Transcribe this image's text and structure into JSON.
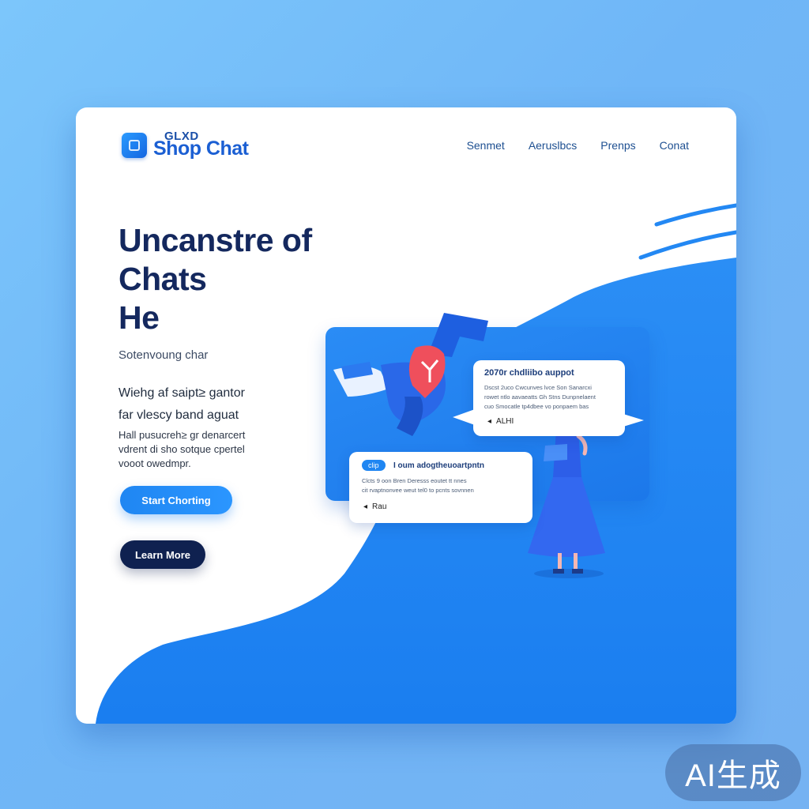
{
  "brand": {
    "small": "GLXD",
    "name": "Shop Chat"
  },
  "nav": [
    "Senmet",
    "Aeruslbcs",
    "Prenps",
    "Conat"
  ],
  "hero": {
    "title_lines": [
      "Uncanstre of",
      "Chats",
      "He"
    ],
    "subtitle": "Sotenvoung char",
    "lead_lines": [
      "Wiehg af saipt≥ gantor",
      "far vlescy band aguat"
    ],
    "body_lines": [
      "Hall pusucreh≥ gr denarcert",
      "vdrent di sho sotque cpertel",
      "vooot owedmpr."
    ]
  },
  "buttons": {
    "primary": "Start Chorting",
    "secondary": "Learn More"
  },
  "chat_bubble_1": {
    "title": "2070r chdliibo auppot",
    "lines": [
      "Dscst 2uco Cwcunves lvce Son Sanarcxi",
      "rowet ntlo aavaeatts Gh Stns Dunpnelaent",
      "cuo Smocatle tp4dbee vo ponpaem bas"
    ],
    "back": "ALHI"
  },
  "chat_bubble_2": {
    "pill": "clip",
    "title": "I oum adogtheuoartpntn",
    "lines": [
      "Clcts 9 oon Bren Deresss eoutet tt nnes",
      "cit rvaptnonvee weut tel0 to pcnts sovnnen"
    ],
    "back": "Rau"
  },
  "watermark": "AI生成",
  "colors": {
    "accent": "#1f86f2",
    "navy": "#14285e",
    "dark_button": "#0f2150",
    "background": "#7cc6fb"
  },
  "icons": [
    "logo-icon",
    "back-arrow-icon",
    "heart-icon"
  ]
}
